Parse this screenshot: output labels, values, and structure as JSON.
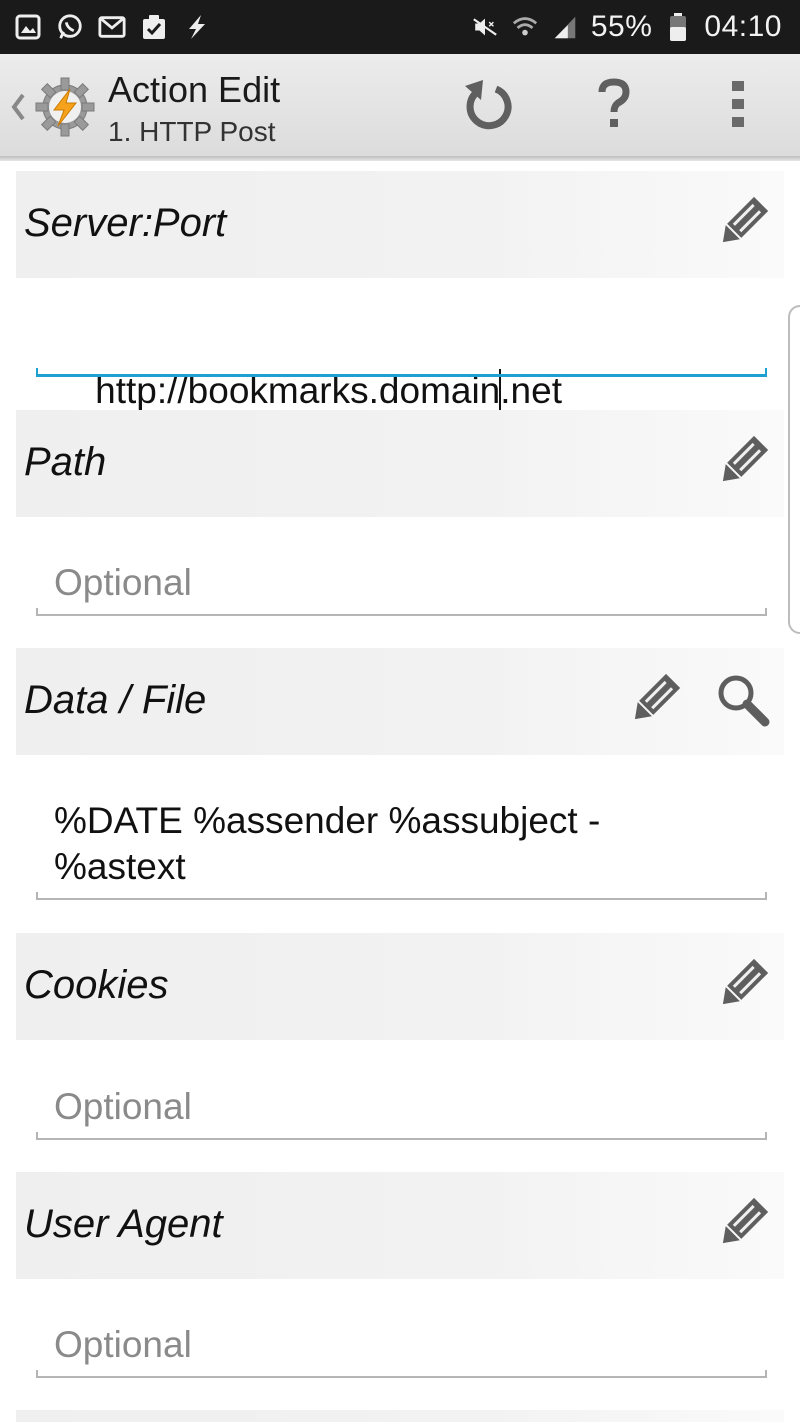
{
  "status_bar": {
    "battery": "55%",
    "time": "04:10",
    "left_icons": [
      "gallery-icon",
      "whatsapp-icon",
      "gmail-icon",
      "clipboard-check-icon",
      "tasker-bolt-icon"
    ],
    "right_icons": [
      "mute-icon",
      "wifi-icon",
      "signal-icon",
      "battery-icon"
    ]
  },
  "header": {
    "title": "Action Edit",
    "subtitle": "1. HTTP Post"
  },
  "sections": {
    "server_port": {
      "label": "Server:Port",
      "value": "http://bookmarks.domain",
      "value_after_cursor": ".net"
    },
    "path": {
      "label": "Path",
      "placeholder": "Optional"
    },
    "data_file": {
      "label": "Data / File",
      "line1": "%DATE %assender %assubject -",
      "line2": "%astext"
    },
    "cookies": {
      "label": "Cookies",
      "placeholder": "Optional"
    },
    "user_agent": {
      "label": "User Agent",
      "placeholder": "Optional"
    }
  },
  "colors": {
    "accent": "#1ea0d0",
    "status_bar_bg": "#1a1a1a",
    "action_bar_bg": "#e4e4e4",
    "icon_gray": "#5f5f5f"
  }
}
